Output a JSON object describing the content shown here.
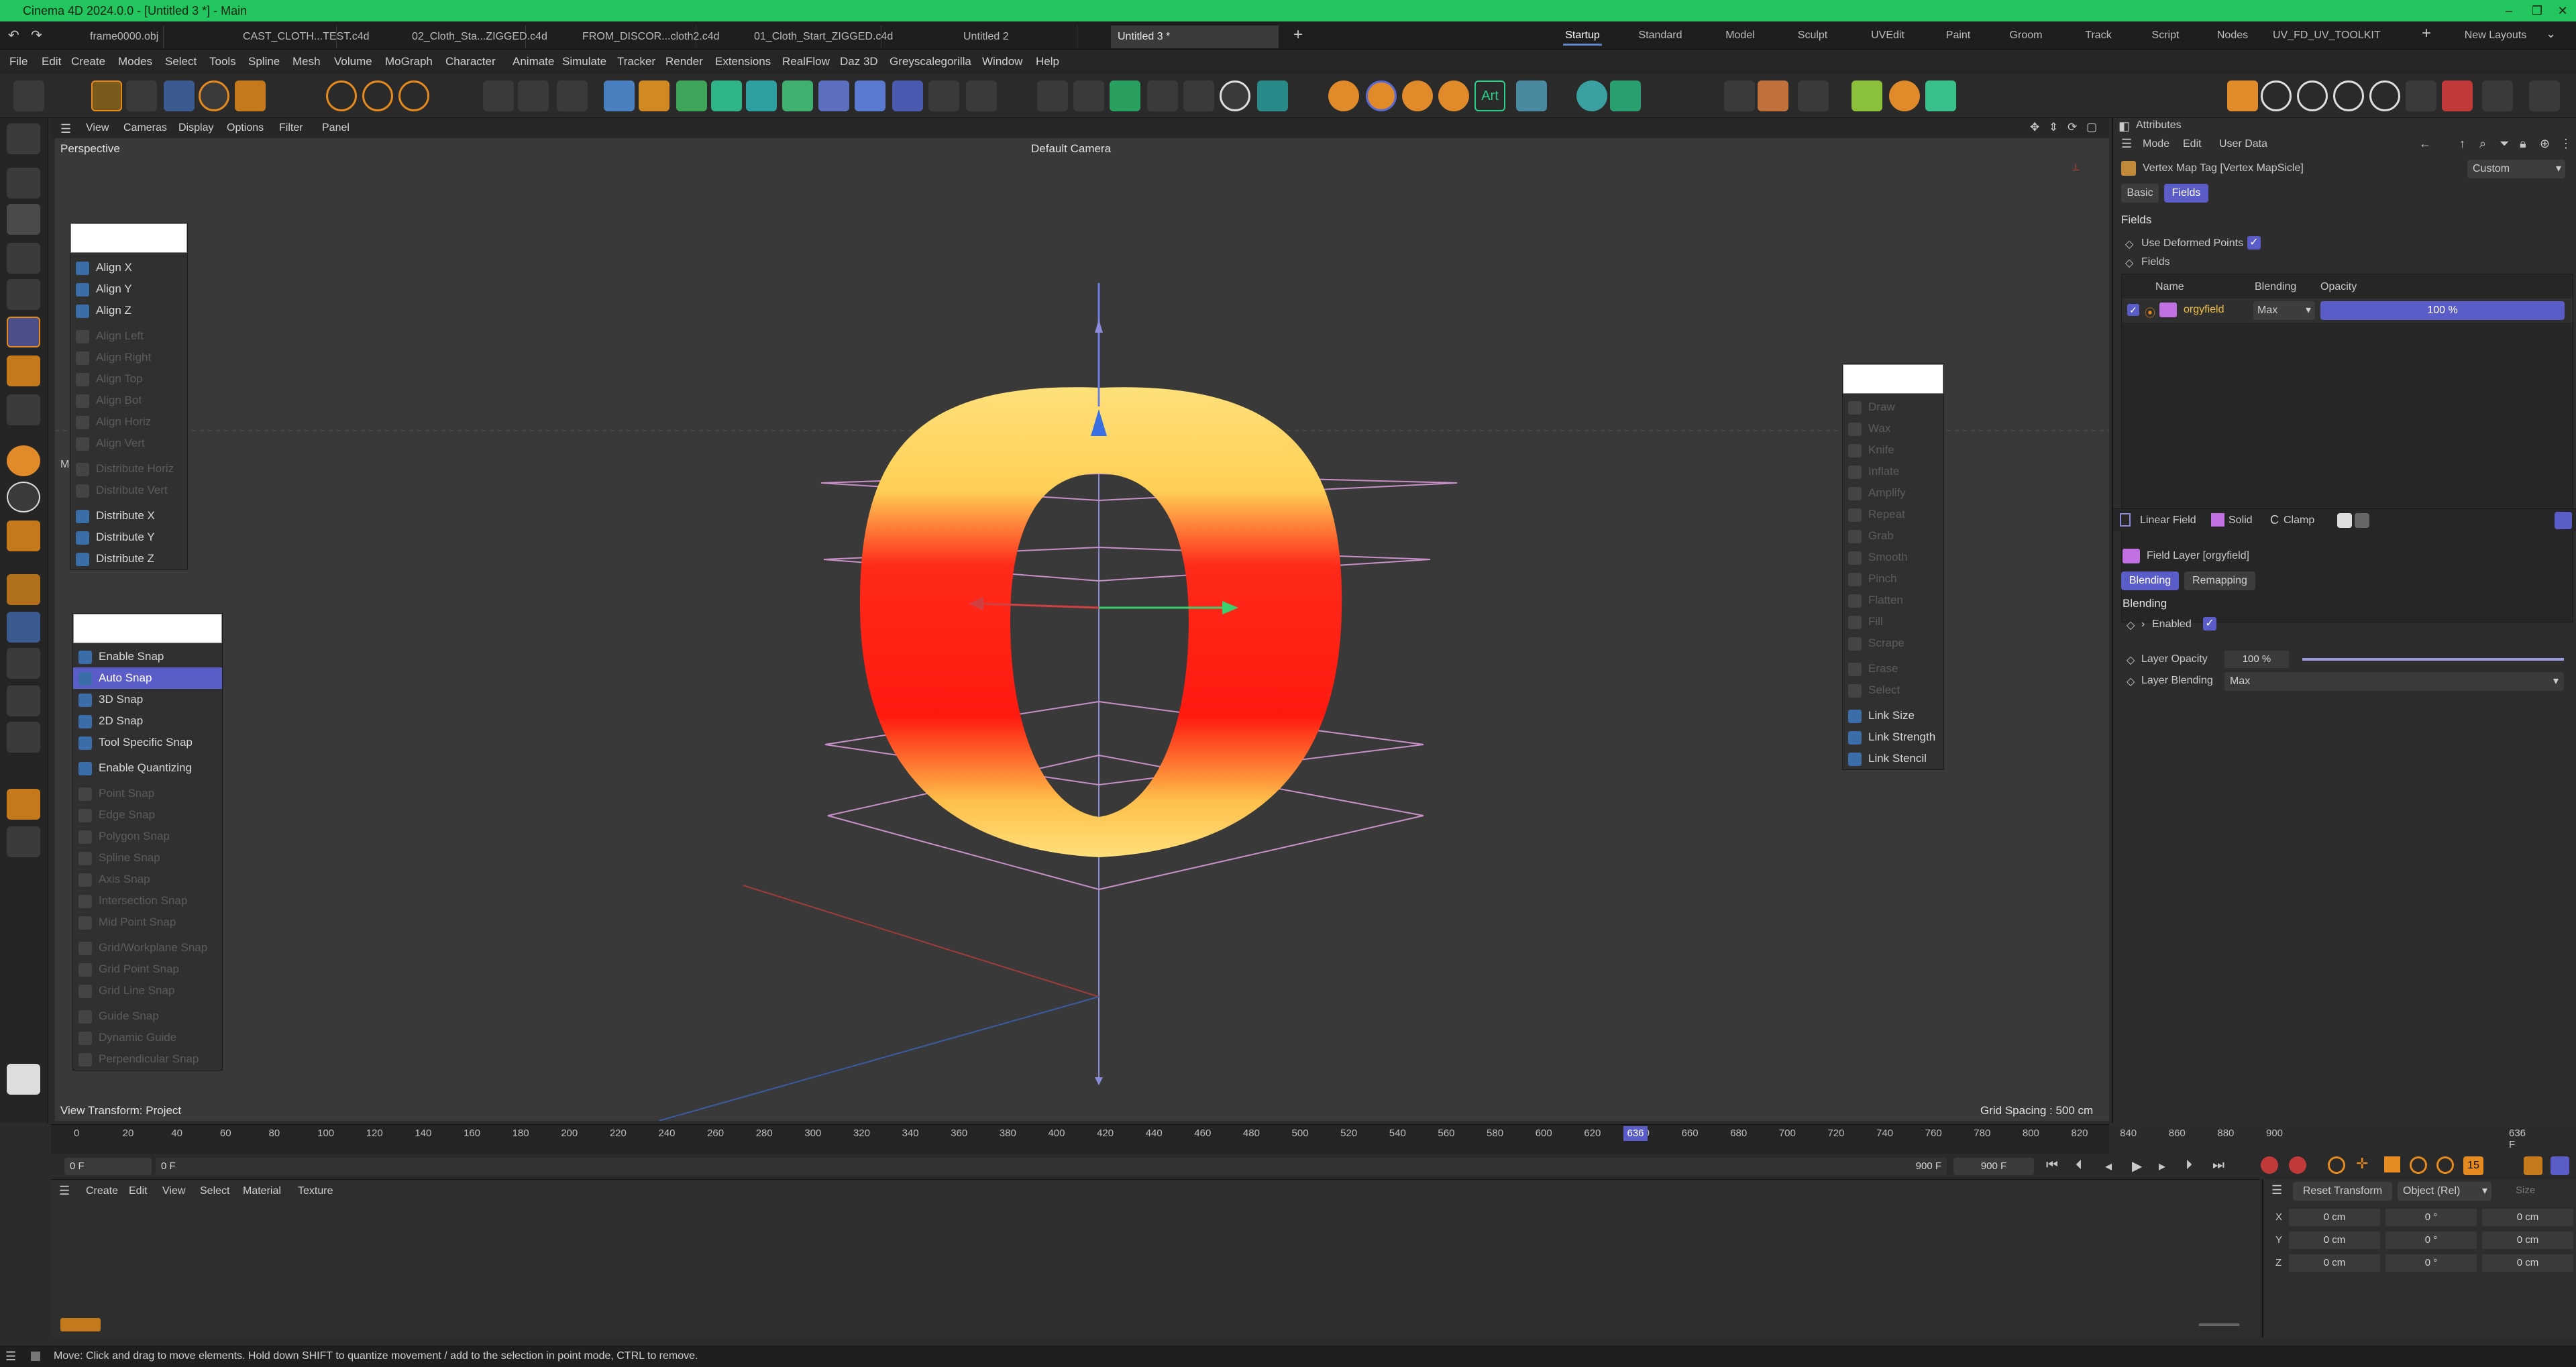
{
  "app": {
    "title": "Cinema 4D 2024.0.0 - [Untitled 3 *] - Main"
  },
  "doc_tabs": [
    "frame0000.obj *",
    "CAST_CLOTH...TEST.c4d *",
    "02_Cloth_Sta...ZIGGED.c4d *",
    "FROM_DISCOR...cloth2.c4d *",
    "01_Cloth_Start_ZIGGED.c4d",
    "Untitled 2",
    "Untitled 3 *"
  ],
  "layouts": [
    "Startup",
    "Standard",
    "Model",
    "Sculpt",
    "UVEdit",
    "Paint",
    "Groom",
    "Track",
    "Script",
    "Nodes",
    "UV_FD_UV_TOOLKIT"
  ],
  "layouts_new": "New Layouts",
  "menus": [
    "File",
    "Edit",
    "Create",
    "Modes",
    "Select",
    "Tools",
    "Spline",
    "Mesh",
    "Volume",
    "MoGraph",
    "Character",
    "Animate",
    "Simulate",
    "Tracker",
    "Render",
    "Extensions",
    "RealFlow",
    "Daz 3D",
    "Greyscalegorilla",
    "Window",
    "Help"
  ],
  "toolbar": {
    "art_label": "Art"
  },
  "view_menus": [
    "View",
    "Cameras",
    "Display",
    "Options",
    "Filter",
    "Panel"
  ],
  "viewport": {
    "label": "Perspective",
    "camera": "Default Camera",
    "view_transform": "View Transform: Project",
    "grid_spacing": "Grid Spacing : 500 cm",
    "side_letter": "M"
  },
  "align_palette": [
    {
      "label": "Align X",
      "enabled": true
    },
    {
      "label": "Align Y",
      "enabled": true
    },
    {
      "label": "Align Z",
      "enabled": true
    },
    {
      "label": "Align Left",
      "enabled": false
    },
    {
      "label": "Align Right",
      "enabled": false
    },
    {
      "label": "Align Top",
      "enabled": false
    },
    {
      "label": "Align Bot",
      "enabled": false
    },
    {
      "label": "Align Horiz",
      "enabled": false
    },
    {
      "label": "Align Vert",
      "enabled": false
    },
    {
      "label": "Distribute Horiz",
      "enabled": false
    },
    {
      "label": "Distribute Vert",
      "enabled": false
    },
    {
      "label": "Distribute X",
      "enabled": true
    },
    {
      "label": "Distribute Y",
      "enabled": true
    },
    {
      "label": "Distribute Z",
      "enabled": true
    }
  ],
  "snap_palette": [
    {
      "label": "Enable Snap",
      "enabled": true
    },
    {
      "label": "Auto Snap",
      "enabled": true,
      "selected": true
    },
    {
      "label": "3D Snap",
      "enabled": true
    },
    {
      "label": "2D Snap",
      "enabled": true
    },
    {
      "label": "Tool Specific Snap",
      "enabled": true
    },
    {
      "label": "Enable Quantizing",
      "enabled": true
    },
    {
      "label": "Point Snap",
      "enabled": false
    },
    {
      "label": "Edge Snap",
      "enabled": false
    },
    {
      "label": "Polygon Snap",
      "enabled": false
    },
    {
      "label": "Spline Snap",
      "enabled": false
    },
    {
      "label": "Axis Snap",
      "enabled": false
    },
    {
      "label": "Intersection Snap",
      "enabled": false
    },
    {
      "label": "Mid Point Snap",
      "enabled": false
    },
    {
      "label": "Grid/Workplane Snap",
      "enabled": false
    },
    {
      "label": "Grid Point Snap",
      "enabled": false
    },
    {
      "label": "Grid Line Snap",
      "enabled": false
    },
    {
      "label": "Guide Snap",
      "enabled": false
    },
    {
      "label": "Dynamic Guide",
      "enabled": false
    },
    {
      "label": "Perpendicular Snap",
      "enabled": false
    }
  ],
  "sculpt_palette": [
    {
      "label": "Draw",
      "enabled": false
    },
    {
      "label": "Wax",
      "enabled": false
    },
    {
      "label": "Knife",
      "enabled": false
    },
    {
      "label": "Inflate",
      "enabled": false
    },
    {
      "label": "Amplify",
      "enabled": false
    },
    {
      "label": "Repeat",
      "enabled": false
    },
    {
      "label": "Grab",
      "enabled": false
    },
    {
      "label": "Smooth",
      "enabled": false
    },
    {
      "label": "Pinch",
      "enabled": false
    },
    {
      "label": "Flatten",
      "enabled": false
    },
    {
      "label": "Fill",
      "enabled": false
    },
    {
      "label": "Scrape",
      "enabled": false
    },
    {
      "label": "Erase",
      "enabled": false
    },
    {
      "label": "Select",
      "enabled": false
    },
    {
      "label": "Link Size",
      "enabled": true
    },
    {
      "label": "Link Strength",
      "enabled": true
    },
    {
      "label": "Link Stencil",
      "enabled": true
    }
  ],
  "attributes": {
    "header": "Attributes",
    "menus": [
      "Mode",
      "Edit",
      "User Data"
    ],
    "object_name": "Vertex Map Tag [Vertex MapSicle]",
    "custom_dropdown": "Custom",
    "tabs": [
      "Basic",
      "Fields"
    ],
    "section_fields": "Fields",
    "use_deformed_points": "Use Deformed Points",
    "fields_label": "Fields",
    "list_headers": [
      "Name",
      "Blending",
      "Opacity"
    ],
    "layer": {
      "name": "orgyfield",
      "blending": "Max",
      "opacity": "100 %"
    },
    "field_types": [
      "Linear Field",
      "Solid",
      "Clamp"
    ],
    "layer_title": "Field Layer [orgyfield]",
    "sub_tabs": [
      "Blending",
      "Remapping"
    ],
    "blending_section": "Blending",
    "enabled_label": "Enabled",
    "layer_opacity_label": "Layer Opacity",
    "layer_opacity_value": "100 %",
    "layer_opacity_fraction": 1.0,
    "layer_blending_label": "Layer Blending",
    "layer_blending_value": "Max"
  },
  "timeline": {
    "ticks": [
      "0",
      "20",
      "40",
      "60",
      "80",
      "100",
      "120",
      "140",
      "160",
      "180",
      "200",
      "220",
      "240",
      "260",
      "280",
      "300",
      "320",
      "340",
      "360",
      "380",
      "400",
      "420",
      "440",
      "460",
      "480",
      "500",
      "520",
      "540",
      "560",
      "580",
      "600",
      "620",
      "640",
      "660",
      "680",
      "700",
      "720",
      "740",
      "760",
      "780",
      "800",
      "820",
      "840",
      "860",
      "880",
      "900"
    ],
    "current_marker": "636",
    "current_frame": "636 F",
    "start_field": "0 F",
    "start_field2": "0 F",
    "end_field": "900 F",
    "end_field2": "900 F",
    "timer_badge": "15"
  },
  "material_manager": {
    "menus": [
      "Create",
      "Edit",
      "View",
      "Select",
      "Material",
      "Texture"
    ]
  },
  "coords": {
    "reset": "Reset Transform",
    "mode": "Object (Rel)",
    "size_label": "Size",
    "rows": [
      {
        "axis": "X",
        "pos": "0 cm",
        "rot": "0 °",
        "size": "0 cm"
      },
      {
        "axis": "Y",
        "pos": "0 cm",
        "rot": "0 °",
        "size": "0 cm"
      },
      {
        "axis": "Z",
        "pos": "0 cm",
        "rot": "0 °",
        "size": "0 cm"
      }
    ]
  },
  "status": "Move: Click and drag to move elements. Hold down SHIFT to quantize movement / add to the selection in point mode, CTRL to remove."
}
